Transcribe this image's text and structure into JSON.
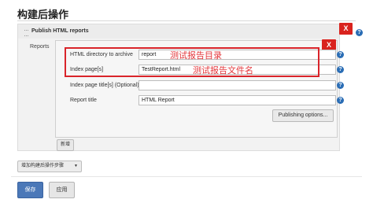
{
  "section": {
    "title": "构建后操作"
  },
  "step": {
    "title": "Publish HTML reports",
    "reports_label": "Reports",
    "close_glyph": "X"
  },
  "fields": [
    {
      "label": "HTML directory to archive",
      "value": "report",
      "annotation": "测试报告目录"
    },
    {
      "label": "Index page[s]",
      "value": "TestReport.html",
      "annotation": "测试报告文件名"
    },
    {
      "label": "Index page title[s] (Optional)",
      "value": ""
    },
    {
      "label": "Report title",
      "value": "HTML Report"
    }
  ],
  "help_glyph": "?",
  "buttons": {
    "publishing_options": "Publishing options...",
    "add": "新增",
    "add_post_build": "增加构建后操作步骤",
    "add_post_build_caret": "▼",
    "save": "保存",
    "apply": "应用"
  },
  "colors": {
    "accent_red": "#d9231e",
    "annotation_red": "#e3363a",
    "primary_blue": "#4b78b8",
    "help_blue": "#2a6db5"
  },
  "icons": [
    "close-icon",
    "help-icon",
    "chevron-down-icon",
    "drag-handle-icon"
  ]
}
